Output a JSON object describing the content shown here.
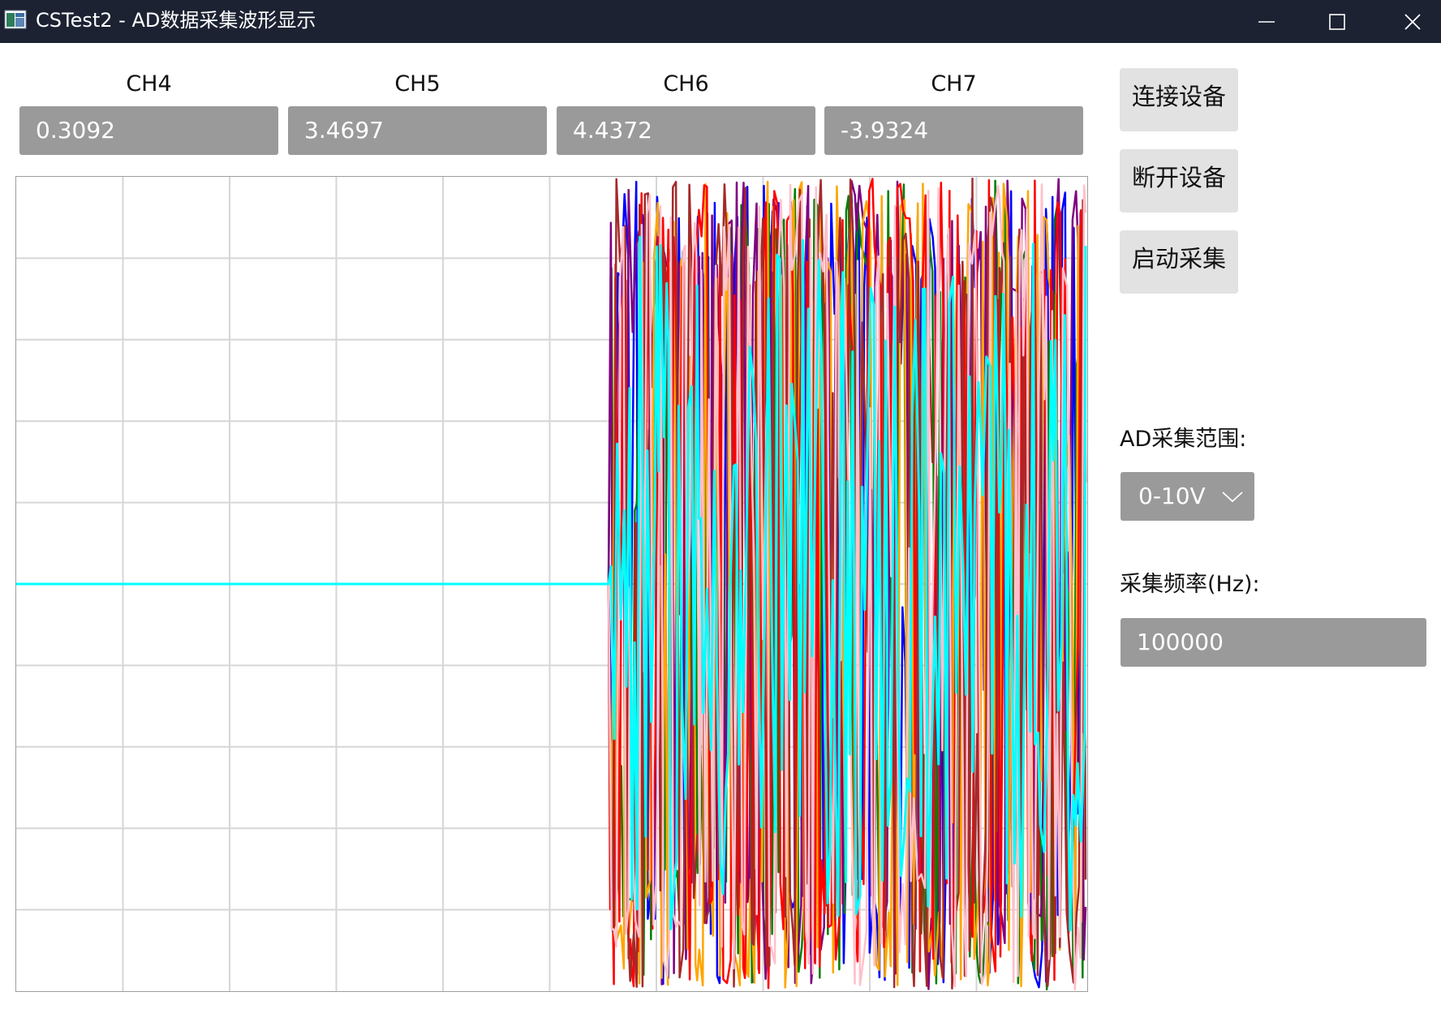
{
  "window": {
    "title": "CSTest2 - AD数据采集波形显示"
  },
  "channels": [
    {
      "label": "CH4",
      "value": "0.3092"
    },
    {
      "label": "CH5",
      "value": "3.4697"
    },
    {
      "label": "CH6",
      "value": "4.4372"
    },
    {
      "label": "CH7",
      "value": "-3.9324"
    }
  ],
  "controls": {
    "connect_label": "连接设备",
    "disconnect_label": "断开设备",
    "start_label": "启动采集",
    "range_label": "AD采集范围:",
    "range_value": "0-10V",
    "freq_label": "采集频率(Hz):",
    "freq_value": "100000"
  },
  "chart_data": {
    "type": "line",
    "grid": true,
    "grid_columns": 10,
    "grid_rows": 10,
    "ylim": [
      -10,
      10
    ],
    "flat_portion_fraction": 0.553,
    "flat_value": 0,
    "series_colors": [
      "#0000ff",
      "#008000",
      "#800080",
      "#ffa500",
      "#ff0000",
      "#a52a2a",
      "#ffc0cb",
      "#00ffff"
    ]
  }
}
